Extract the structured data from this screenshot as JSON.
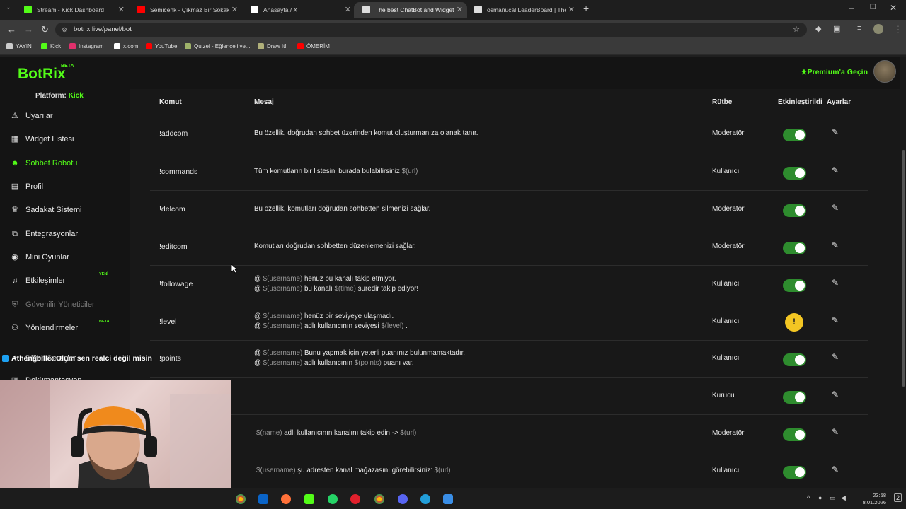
{
  "browser": {
    "tabs": [
      {
        "title": "Stream - Kick Dashboard",
        "icon": "kick-icon",
        "color": "#53fc18",
        "active": false
      },
      {
        "title": "Semicenk - Çıkmaz Bir Sokakta",
        "icon": "youtube-icon",
        "color": "#ff0000",
        "active": false
      },
      {
        "title": "Anasayfa / X",
        "icon": "x-icon",
        "color": "#ffffff",
        "active": false
      },
      {
        "title": "The best ChatBot and Widgets",
        "icon": "botrix-icon",
        "color": "#dddddd",
        "active": true
      },
      {
        "title": "osmanucal LeaderBoard | The b",
        "icon": "botrix-icon",
        "color": "#dddddd",
        "active": false
      }
    ],
    "url": "botrix.live/panel/bot",
    "bookmarks": [
      {
        "label": "YAYIN",
        "icon": "folder-icon",
        "color": "#cccccc"
      },
      {
        "label": "Kick",
        "icon": "kick-icon",
        "color": "#53fc18"
      },
      {
        "label": "Instagram",
        "icon": "instagram-icon",
        "color": "#e1306c"
      },
      {
        "label": "x.com",
        "icon": "x-icon",
        "color": "#ffffff"
      },
      {
        "label": "YouTube",
        "icon": "youtube-icon",
        "color": "#ff0000"
      },
      {
        "label": "Quizei - Eğlenceli ve...",
        "icon": "quiz-icon",
        "color": "#9fb36a"
      },
      {
        "label": "Draw It!",
        "icon": "draw-icon",
        "color": "#b0b07a"
      },
      {
        "label": "ÖMERİM",
        "icon": "youtube-icon",
        "color": "#ff0000"
      }
    ]
  },
  "app": {
    "logo": "BotRix",
    "beta": "BETA",
    "premium": "Premium'a Geçin",
    "accent": "#53fc18"
  },
  "sidebar": {
    "platform_label": "Platform:",
    "platform_value": "Kick",
    "items": [
      {
        "label": "Uyarılar",
        "icon": "warning-icon"
      },
      {
        "label": "Widget Listesi",
        "icon": "grid-icon"
      },
      {
        "label": "Sohbet Robotu",
        "icon": "robot-icon"
      },
      {
        "label": "Profil",
        "icon": "profile-card-icon"
      },
      {
        "label": "Sadakat Sistemi",
        "icon": "trophy-icon"
      },
      {
        "label": "Entegrasyonlar",
        "icon": "integration-icon"
      },
      {
        "label": "Mini Oyunlar",
        "icon": "gamepad-icon"
      },
      {
        "label": "Etkileşimler",
        "icon": "music-note-icon",
        "badge": "YENİ"
      },
      {
        "label": "Güvenilir Yöneticiler",
        "icon": "shield-icon"
      },
      {
        "label": "Yönlendirmeler",
        "icon": "users-icon",
        "badge": "BETA"
      },
      {
        "label": "Diğer Gereçler",
        "icon": "tools-icon"
      },
      {
        "label": "Dokümantasyon",
        "icon": "doc-icon"
      }
    ]
  },
  "table": {
    "headers": {
      "command": "Komut",
      "message": "Mesaj",
      "rank": "Rütbe",
      "enabled": "Etkinleştirildi",
      "settings": "Ayarlar"
    },
    "rows": [
      {
        "command": "!addcom",
        "lines": [
          [
            {
              "t": "Bu özellik, doğrudan sohbet üzerinden komut oluşturmanıza olanak tanır."
            }
          ]
        ],
        "rank": "Moderatör",
        "state": "on"
      },
      {
        "command": "!commands",
        "lines": [
          [
            {
              "t": "Tüm komutların bir listesini burada bulabilirsiniz "
            },
            {
              "t": "$(url)",
              "v": true
            }
          ]
        ],
        "rank": "Kullanıcı",
        "state": "on"
      },
      {
        "command": "!delcom",
        "lines": [
          [
            {
              "t": "Bu özellik, komutları doğrudan sohbetten silmenizi sağlar."
            }
          ]
        ],
        "rank": "Moderatör",
        "state": "on"
      },
      {
        "command": "!editcom",
        "lines": [
          [
            {
              "t": "Komutları doğrudan sohbetten düzenlemenizi sağlar."
            }
          ]
        ],
        "rank": "Moderatör",
        "state": "on"
      },
      {
        "command": "!followage",
        "lines": [
          [
            {
              "t": "@ "
            },
            {
              "t": "$(username)",
              "v": true
            },
            {
              "t": " henüz bu kanalı takip etmiyor."
            }
          ],
          [
            {
              "t": "@ "
            },
            {
              "t": "$(username)",
              "v": true
            },
            {
              "t": " bu kanalı "
            },
            {
              "t": "$(time)",
              "v": true
            },
            {
              "t": " süredir takip ediyor!"
            }
          ]
        ],
        "rank": "Kullanıcı",
        "state": "on"
      },
      {
        "command": "!level",
        "lines": [
          [
            {
              "t": "@ "
            },
            {
              "t": "$(username)",
              "v": true
            },
            {
              "t": " henüz bir seviyeye ulaşmadı."
            }
          ],
          [
            {
              "t": "@ "
            },
            {
              "t": "$(username)",
              "v": true
            },
            {
              "t": " adlı kullanıcının seviyesi "
            },
            {
              "t": "$(level)",
              "v": true
            },
            {
              "t": " ."
            }
          ]
        ],
        "rank": "Kullanıcı",
        "state": "warning"
      },
      {
        "command": "!points",
        "lines": [
          [
            {
              "t": "@ "
            },
            {
              "t": "$(username)",
              "v": true
            },
            {
              "t": " Bunu yapmak için yeterli puanınız bulunmamaktadır."
            }
          ],
          [
            {
              "t": "@ "
            },
            {
              "t": "$(username)",
              "v": true
            },
            {
              "t": " adlı kullanıcının "
            },
            {
              "t": "$(points)",
              "v": true
            },
            {
              "t": " puanı var."
            }
          ]
        ],
        "rank": "Kullanıcı",
        "state": "on"
      },
      {
        "command": "",
        "lines": [],
        "rank": "Kurucu",
        "state": "on"
      },
      {
        "command": "",
        "lines": [
          [
            {
              "t": "$(name)",
              "v": true
            },
            {
              "t": " adlı kullanıcının kanalını takip edin -> "
            },
            {
              "t": "$(url)",
              "v": true
            }
          ]
        ],
        "rank": "Moderatör",
        "state": "on"
      },
      {
        "command": "",
        "lines": [
          [
            {
              "t": "$(username)",
              "v": true
            },
            {
              "t": " şu adresten kanal mağazasını görebilirsiniz: "
            },
            {
              "t": "$(url)",
              "v": true
            }
          ]
        ],
        "rank": "Kullanıcı",
        "state": "on"
      }
    ]
  },
  "overlay": {
    "chat_user": "Athenabille",
    "chat_text": ": Olum sen realci değil misin"
  },
  "taskbar": {
    "time": "23:58",
    "date": "8.01.2026",
    "notifications": "2"
  }
}
